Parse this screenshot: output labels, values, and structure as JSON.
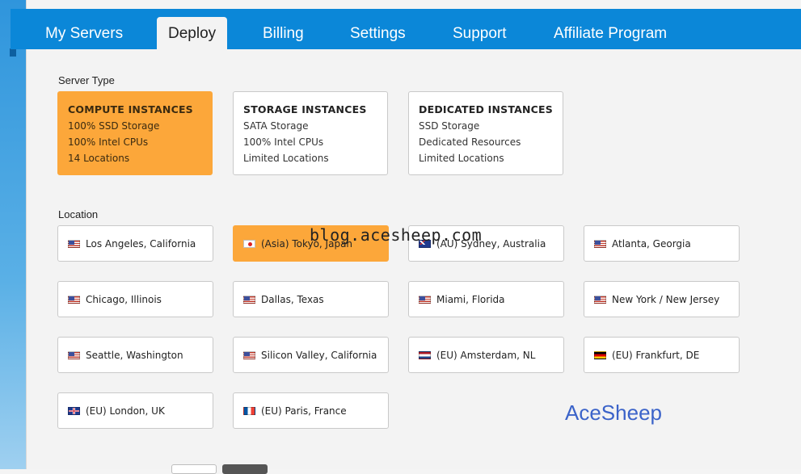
{
  "nav": {
    "tabs": [
      {
        "label": "My Servers"
      },
      {
        "label": "Deploy",
        "active": true
      },
      {
        "label": "Billing"
      },
      {
        "label": "Settings"
      },
      {
        "label": "Support"
      },
      {
        "label": "Affiliate Program"
      }
    ]
  },
  "server_type": {
    "label": "Server Type",
    "options": [
      {
        "title": "COMPUTE INSTANCES",
        "lines": [
          "100% SSD Storage",
          "100% Intel CPUs",
          "14 Locations"
        ],
        "selected": true
      },
      {
        "title": "STORAGE INSTANCES",
        "lines": [
          "SATA Storage",
          "100% Intel CPUs",
          "Limited Locations"
        ]
      },
      {
        "title": "DEDICATED INSTANCES",
        "lines": [
          "SSD Storage",
          "Dedicated Resources",
          "Limited Locations"
        ]
      }
    ]
  },
  "location": {
    "label": "Location",
    "options": [
      {
        "name": "Los Angeles, California",
        "flag": "us-flag-icon"
      },
      {
        "name": "(Asia) Tokyo, Japan",
        "flag": "jp-flag-icon",
        "selected": true
      },
      {
        "name": "(AU) Sydney, Australia",
        "flag": "au-flag-icon"
      },
      {
        "name": "Atlanta, Georgia",
        "flag": "us-flag-icon"
      },
      {
        "name": "Chicago, Illinois",
        "flag": "us-flag-icon"
      },
      {
        "name": "Dallas, Texas",
        "flag": "us-flag-icon"
      },
      {
        "name": "Miami, Florida",
        "flag": "us-flag-icon"
      },
      {
        "name": "New York / New Jersey",
        "flag": "us-flag-icon"
      },
      {
        "name": "Seattle, Washington",
        "flag": "us-flag-icon"
      },
      {
        "name": "Silicon Valley, California",
        "flag": "us-flag-icon"
      },
      {
        "name": "(EU) Amsterdam, NL",
        "flag": "nl-flag-icon"
      },
      {
        "name": "(EU) Frankfurt, DE",
        "flag": "de-flag-icon"
      },
      {
        "name": "(EU) London, UK",
        "flag": "uk-flag-icon"
      },
      {
        "name": "(EU) Paris, France",
        "flag": "fr-flag-icon"
      }
    ]
  },
  "watermark": {
    "text": "blog.acesheep.com"
  },
  "brand": {
    "text": "AceSheep"
  },
  "colors": {
    "nav_bg": "#0b87d8",
    "selected_bg": "#fca73a",
    "brand": "#3b63c9"
  }
}
